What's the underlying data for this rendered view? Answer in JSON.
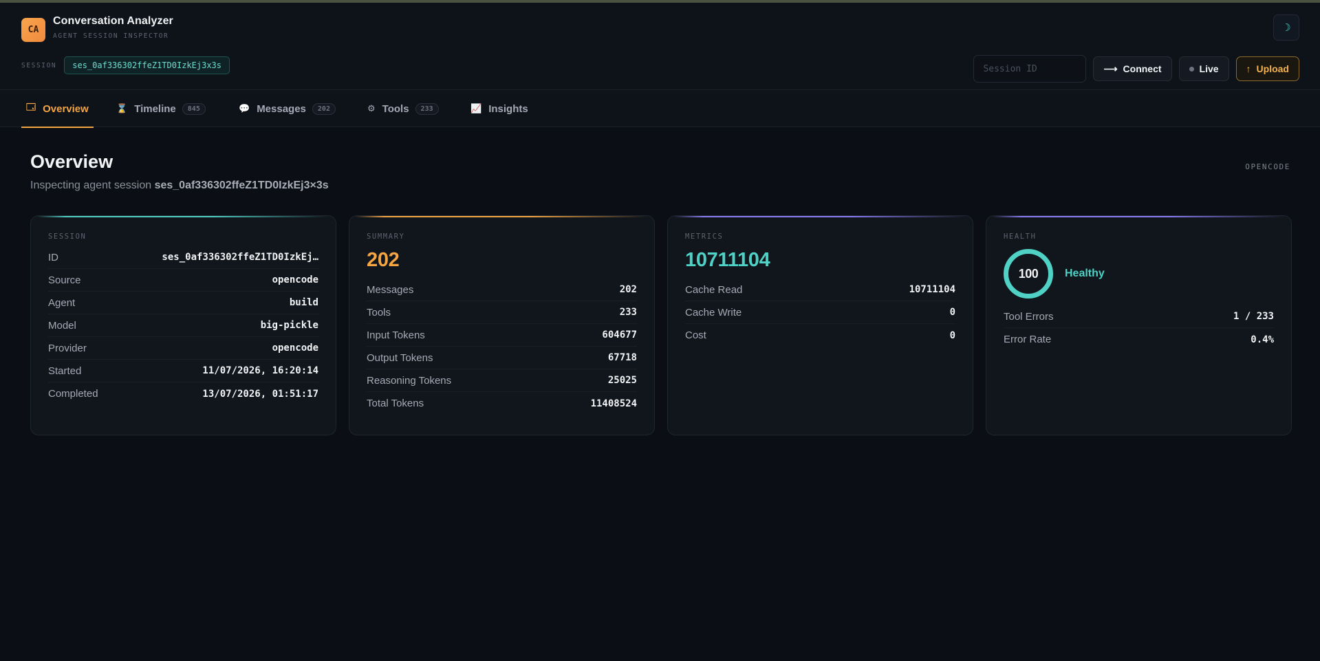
{
  "app": {
    "logo_text": "CA",
    "title": "Conversation Analyzer",
    "subtitle": "AGENT SESSION INSPECTOR",
    "theme_icon": "☽"
  },
  "session_bar": {
    "label": "SESSION",
    "session_id": "ses_0af336302ffeZ1TD0IzkEj3x3s",
    "input_placeholder": "Session ID",
    "connect_label": "Connect",
    "live_label": "Live",
    "upload_label": "Upload"
  },
  "tabs": [
    {
      "icon": "🗔",
      "label": "Overview",
      "badge": ""
    },
    {
      "icon": "⌛",
      "label": "Timeline",
      "badge": "845"
    },
    {
      "icon": "💬",
      "label": "Messages",
      "badge": "202"
    },
    {
      "icon": "⚙",
      "label": "Tools",
      "badge": "233"
    },
    {
      "icon": "📈",
      "label": "Insights",
      "badge": ""
    }
  ],
  "page": {
    "title": "Overview",
    "subtitle_prefix": "Inspecting agent session",
    "subtitle_session": "ses_0af336302ffeZ1TD0IzkEj3×3s",
    "source_tag": "OPENCODE"
  },
  "cards": {
    "session": {
      "label": "SESSION",
      "rows": [
        {
          "k": "ID",
          "v": "ses_0af336302ffeZ1TD0IzkEj…"
        },
        {
          "k": "Source",
          "v": "opencode"
        },
        {
          "k": "Agent",
          "v": "build"
        },
        {
          "k": "Model",
          "v": "big-pickle"
        },
        {
          "k": "Provider",
          "v": "opencode"
        },
        {
          "k": "Started",
          "v": "11/07/2026, 16:20:14"
        },
        {
          "k": "Completed",
          "v": "13/07/2026, 01:51:17"
        }
      ]
    },
    "summary": {
      "label": "SUMMARY",
      "big": "202",
      "rows": [
        {
          "k": "Messages",
          "v": "202"
        },
        {
          "k": "Tools",
          "v": "233"
        },
        {
          "k": "Input Tokens",
          "v": "604677"
        },
        {
          "k": "Output Tokens",
          "v": "67718"
        },
        {
          "k": "Reasoning Tokens",
          "v": "25025"
        },
        {
          "k": "Total Tokens",
          "v": "11408524"
        }
      ]
    },
    "metrics": {
      "label": "METRICS",
      "big": "10711104",
      "rows": [
        {
          "k": "Cache Read",
          "v": "10711104"
        },
        {
          "k": "Cache Write",
          "v": "0"
        },
        {
          "k": "Cost",
          "v": "0"
        }
      ]
    },
    "health": {
      "label": "HEALTH",
      "score": "100",
      "status": "Healthy",
      "rows": [
        {
          "k": "Tool Errors",
          "v": "1 / 233"
        },
        {
          "k": "Error Rate",
          "v": "0.4%"
        }
      ]
    }
  },
  "colors": {
    "accent_amber": "#f5a542",
    "accent_teal": "#4fd1c5",
    "accent_violet": "#8b7cf6",
    "background": "#0b0e14"
  }
}
